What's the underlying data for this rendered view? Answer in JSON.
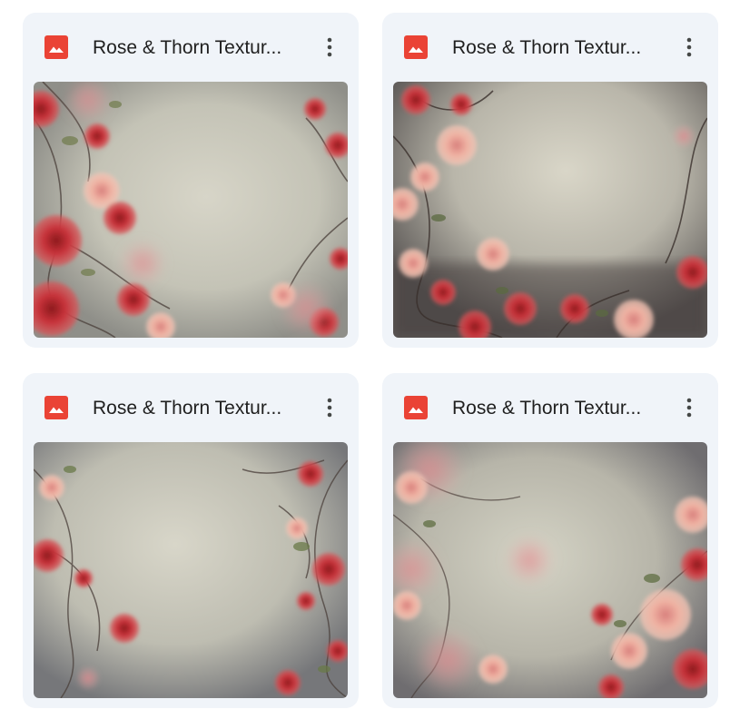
{
  "files": [
    {
      "title": "Rose & Thorn Textur...",
      "icon": "image-file-icon",
      "thumbnail": "rose-texture-thumbnail"
    },
    {
      "title": "Rose & Thorn Textur...",
      "icon": "image-file-icon",
      "thumbnail": "rose-texture-thumbnail"
    },
    {
      "title": "Rose & Thorn Textur...",
      "icon": "image-file-icon",
      "thumbnail": "rose-texture-thumbnail"
    },
    {
      "title": "Rose & Thorn Textur...",
      "icon": "image-file-icon",
      "thumbnail": "rose-texture-thumbnail"
    }
  ],
  "colors": {
    "card_background": "#f0f4f9",
    "image_icon": "#ea4335",
    "title_text": "#1f1f1f",
    "more_icon": "#444746"
  }
}
